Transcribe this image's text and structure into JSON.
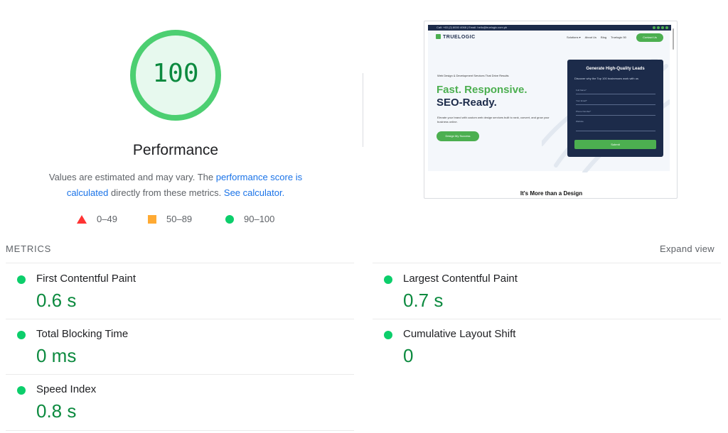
{
  "performance": {
    "score": "100",
    "score_fraction": 1.0,
    "title": "Performance",
    "desc_prefix": "Values are estimated and may vary. The ",
    "desc_link1": "performance score is calculated",
    "desc_middle": " directly from these metrics. ",
    "desc_link2": "See calculator.",
    "colors": {
      "pass": "#0cce6b",
      "pass_text": "#0c8a3f",
      "average": "#ffaa33",
      "fail": "#ff3333"
    }
  },
  "legend": {
    "fail": "0–49",
    "average": "50–89",
    "pass": "90–100"
  },
  "thumbnail": {
    "topbar_text": "Call: +63 (2) 8000 4068  |  Email: hello@truelogic.com.ph",
    "logo": "TRUELOGIC",
    "nav": [
      "Solutions ▾",
      "About Us",
      "Blog",
      "Truelogic 50"
    ],
    "contact": "Contact Us",
    "eyebrow": "Web Design & Development Services That Drive Results",
    "headline_green": "Fast. Responsive.",
    "headline_dark": "SEO-Ready.",
    "body": "Elevate your brand with custom web design services built to rank, convert, and grow your business online.",
    "cta": "Design My Success",
    "form_title": "Generate High-Quality Leads",
    "form_sub": "Discover why the Top 100 businesses work with us",
    "fields": [
      "Full Name*",
      "Your Email*",
      "Phone Number*",
      "Website"
    ],
    "submit": "Submit",
    "bottom_title": "It's More than a Design"
  },
  "metrics": {
    "label": "METRICS",
    "expand": "Expand view",
    "items": [
      {
        "title": "First Contentful Paint",
        "value": "0.6 s"
      },
      {
        "title": "Largest Contentful Paint",
        "value": "0.7 s"
      },
      {
        "title": "Total Blocking Time",
        "value": "0 ms"
      },
      {
        "title": "Cumulative Layout Shift",
        "value": "0"
      },
      {
        "title": "Speed Index",
        "value": "0.8 s"
      }
    ]
  }
}
